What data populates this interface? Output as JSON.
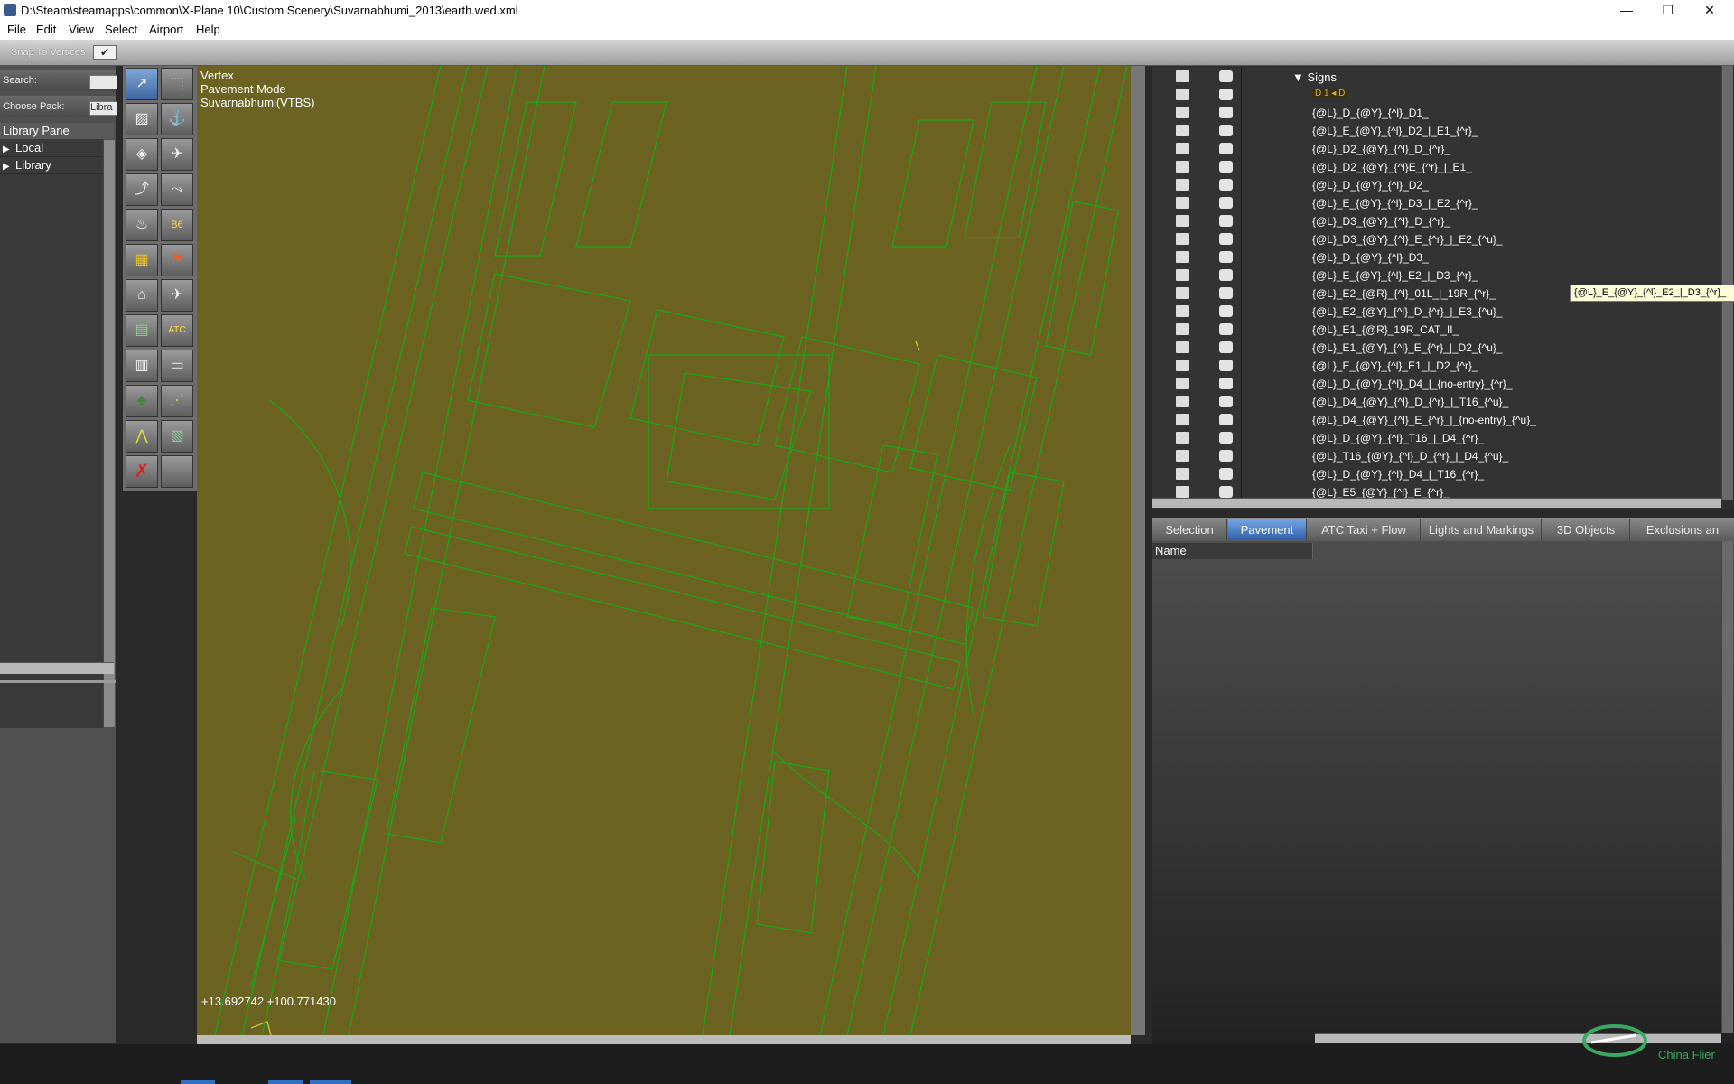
{
  "window": {
    "title": "D:\\Steam\\steamapps\\common\\X-Plane 10\\Custom Scenery\\Suvarnabhumi_2013\\earth.wed.xml",
    "minimize": "—",
    "restore": "❐",
    "close": "✕"
  },
  "menu": [
    "File",
    "Edit",
    "View",
    "Select",
    "Airport",
    "Help"
  ],
  "snap": {
    "label": "Snap To Vertices",
    "checked": "✔"
  },
  "library": {
    "search_label": "Search:",
    "search_value": "",
    "pack_label": "Choose Pack:",
    "pack_value": "Libra",
    "pane_title": "Library Pane",
    "items": [
      "Local",
      "Library"
    ]
  },
  "tools": [
    {
      "icon": "vertex-select-icon",
      "glyph": "↗"
    },
    {
      "icon": "marquee-icon",
      "glyph": "⬚"
    },
    {
      "icon": "runway-icon",
      "glyph": "▨"
    },
    {
      "icon": "sealane-icon",
      "glyph": "⚓"
    },
    {
      "icon": "taxiway-icon",
      "glyph": "◈"
    },
    {
      "icon": "helipad-icon",
      "glyph": "✈"
    },
    {
      "icon": "bezier-line-icon",
      "glyph": "⤴"
    },
    {
      "icon": "taxi-route-icon",
      "glyph": "⤳"
    },
    {
      "icon": "light-fixture-icon",
      "glyph": "♨"
    },
    {
      "icon": "sign-icon",
      "glyph": "B6"
    },
    {
      "icon": "object-icon",
      "glyph": "▦"
    },
    {
      "icon": "windsock-icon",
      "glyph": "⚑"
    },
    {
      "icon": "tower-viewpoint-icon",
      "glyph": "⌂"
    },
    {
      "icon": "ramp-start-icon",
      "glyph": "✈"
    },
    {
      "icon": "facade-icon",
      "glyph": "▤"
    },
    {
      "icon": "atc-icon",
      "glyph": "ATC"
    },
    {
      "icon": "building-icon",
      "glyph": "▥"
    },
    {
      "icon": "boundary-icon",
      "glyph": "▭"
    },
    {
      "icon": "forest-icon",
      "glyph": "♣"
    },
    {
      "icon": "string-icon",
      "glyph": "⋰"
    },
    {
      "icon": "line-icon",
      "glyph": "⋀"
    },
    {
      "icon": "polygon-icon",
      "glyph": "▧"
    },
    {
      "icon": "exclusion-icon",
      "glyph": "✗"
    },
    {
      "icon": "blank-tool-icon",
      "glyph": ""
    }
  ],
  "map": {
    "mode_line1": "Vertex",
    "mode_line2": "Pavement Mode",
    "mode_line3": "Suvarnabhumi(VTBS)",
    "coords": "+13.692742 +100.771430",
    "bg_color": "#6c6322",
    "line_color": "#1aa81a"
  },
  "hierarchy": {
    "group": "Signs",
    "sign_preview": "D 1 ◂ D",
    "rows": [
      "{@L}_D_{@Y}_{^l}_D1_",
      "{@L}_E_{@Y}_{^l}_D2_|_E1_{^r}_",
      "{@L}_D2_{@Y}_{^l}_D_{^r}_",
      "{@L}_D2_{@Y}_{^l}E_{^r}_|_E1_",
      "{@L}_D_{@Y}_{^l}_D2_",
      "{@L}_E_{@Y}_{^l}_D3_|_E2_{^r}_",
      "{@L}_D3_{@Y}_{^l}_D_{^r}_",
      "{@L}_D3_{@Y}_{^l}_E_{^r}_|_E2_{^u}_",
      "{@L}_D_{@Y}_{^l}_D3_",
      "{@L}_E_{@Y}_{^l}_E2_|_D3_{^r}_",
      "{@L}_E2_{@R}_{^l}_01L_|_19R_{^r}_",
      "{@L}_E2_{@Y}_{^l}_D_{^r}_|_E3_{^u}_",
      "{@L}_E1_{@R}_19R_CAT_II_",
      "{@L}_E1_{@Y}_{^l}_E_{^r}_|_D2_{^u}_",
      "{@L}_E_{@Y}_{^l}_E1_|_D2_{^r}_",
      "{@L}_D_{@Y}_{^l}_D4_|_{no-entry}_{^r}_",
      "{@L}_D4_{@Y}_{^l}_D_{^r}_|_T16_{^u}_",
      "{@L}_D4_{@Y}_{^l}_E_{^r}_|_{no-entry}_{^u}_",
      "{@L}_D_{@Y}_{^l}_T16_|_D4_{^r}_",
      "{@L}_T16_{@Y}_{^l}_D_{^r}_|_D4_{^u}_",
      "{@L}_D_{@Y}_{^l}_D4_|_T16_{^r}_",
      "{@L}_E5_{@Y}_{^l}_E_{^r}_"
    ],
    "tooltip": "{@L}_E_{@Y}_{^l}_E2_|_D3_{^r}_"
  },
  "tabs": [
    "Selection",
    "Pavement",
    "ATC Taxi + Flow",
    "Lights and Markings",
    "3D Objects",
    "Exclusions an"
  ],
  "active_tab": "Pavement",
  "properties": {
    "name_header": "Name"
  },
  "watermark": "China Flier"
}
